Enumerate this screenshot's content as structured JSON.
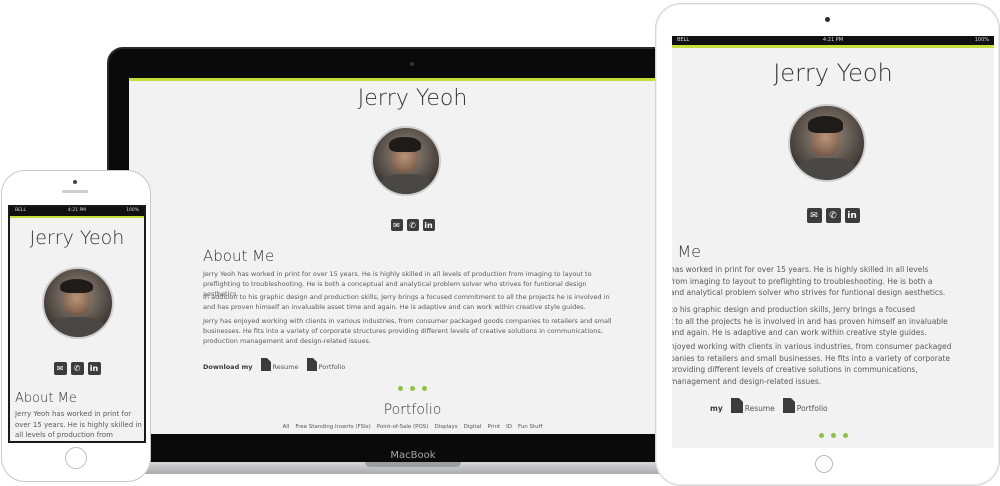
{
  "profile": {
    "name": "Jerry Yeoh",
    "about_title": "About Me",
    "paragraphs": [
      "Jerry Yeoh has worked in print for over 15 years. He is highly skilled in all levels of production from imaging to layout to preflighting to troubleshooting. He is both a conceptual and analytical problem solver who strives for funtional design aesthetics.",
      "In addition to his graphic design and production skills, Jerry brings a focused commitment to all the projects he is involved in and has proven himself an invaluable asset time and again. He is adaptive and can work within creative style guides.",
      "Jerry has enjoyed working with clients in various industries, from consumer packaged goods companies to retailers and small businesses. He fits into a variety of corporate structures providing different levels of creative solutions in communications, production management and design-related issues."
    ],
    "tablet_paragraph_lines": [
      [
        "has worked in print for over 15 years. He is highly skilled in all levels",
        "from imaging to layout to preflighting to troubleshooting. He is both a",
        "and analytical problem solver who strives for funtional design aesthetics."
      ],
      [
        "to his graphic design and production skills, Jerry brings a focused",
        "t to all the projects he is involved in and has proven himself an invaluable",
        "and again. He is adaptive and can work within creative style guides."
      ],
      [
        "njoyed working with clients in various industries, from consumer packaged",
        "panies to retailers and small businesses. He fits into a variety of corporate",
        "providing different levels of creative solutions in communications,",
        "management and design-related issues."
      ]
    ],
    "tablet_about_title": "t Me",
    "tablet_download_label": "my",
    "phone_paragraph": "Jerry Yeoh has worked in print for over 15 years. He is highly skilled in all levels of production from imaging to layout to",
    "contact_icons": [
      "envelope-icon",
      "phone-icon",
      "linkedin-icon"
    ],
    "download": {
      "label": "Download my",
      "resume": "Resume",
      "portfolio": "Portfolio"
    },
    "portfolio_title": "Portfolio",
    "portfolio_filters": [
      "All",
      "Free Standing Inserts (FSIs)",
      "Point-of-Sale (POS)",
      "Displays",
      "Digital",
      "Print",
      "ID",
      "Fun Stuff"
    ]
  },
  "devices": {
    "laptop_brand": "MacBook",
    "status_bar": {
      "carrier": "BELL",
      "time": "4:21 PM",
      "battery": "100%"
    }
  },
  "colors": {
    "accent": "#8cc63f",
    "accent_line": "#c4df3a",
    "background": "#f2f2f2",
    "bezel": "#0a0a0a"
  }
}
